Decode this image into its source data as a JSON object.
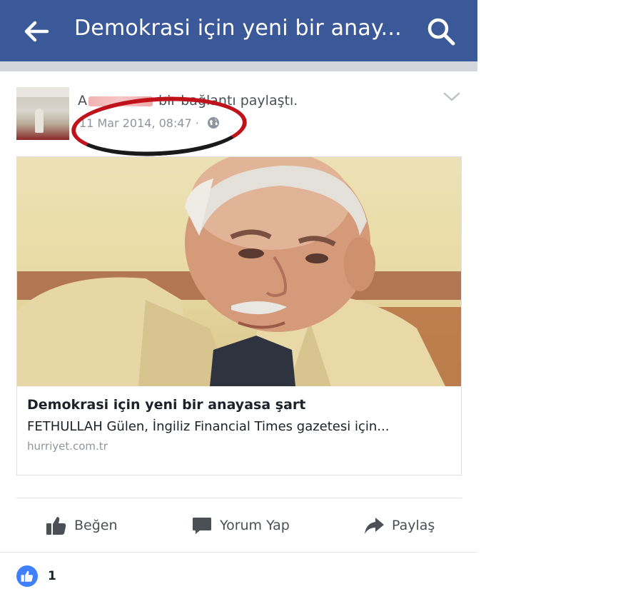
{
  "header": {
    "title": "Demokrasi için yeni bir anay...",
    "bar_color": "#3b5998"
  },
  "post": {
    "author_visible_start": "A",
    "author_action": "bir bağlantı paylaştı.",
    "timestamp": "11 Mar 2014, 08:47 ·",
    "highlight_color": "#c0121b"
  },
  "link": {
    "title": "Demokrasi için yeni bir anayasa şart",
    "description": "FETHULLAH Gülen, İngiliz Financial Times gazetesi için...",
    "domain": "hurriyet.com.tr"
  },
  "actions": {
    "like": "Beğen",
    "comment": "Yorum Yap",
    "share": "Paylaş"
  },
  "reactions": {
    "count": "1",
    "badge_color": "#4080ff"
  },
  "icons": [
    "back-arrow-icon",
    "search-icon",
    "globe-icon",
    "chevron-down-icon",
    "thumbs-up-icon",
    "comment-icon",
    "share-icon"
  ]
}
